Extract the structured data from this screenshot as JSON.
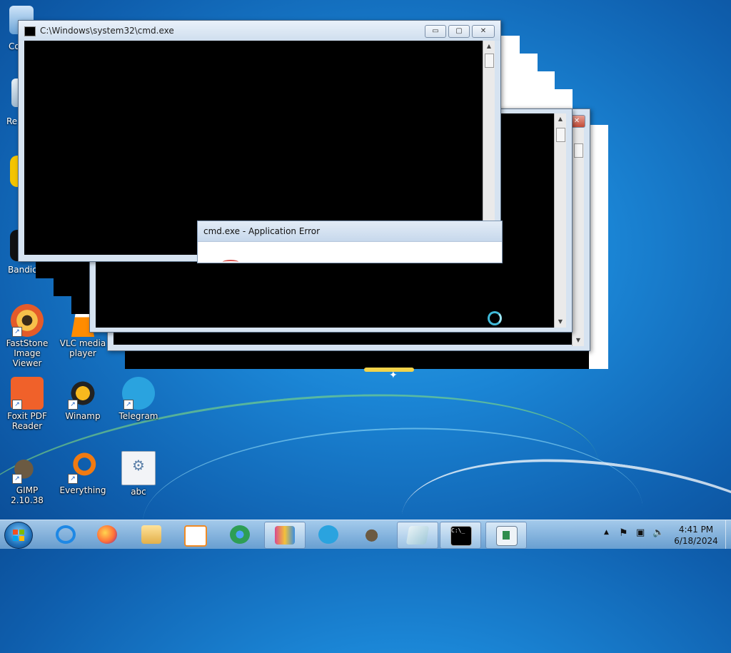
{
  "desktop": {
    "icons": [
      {
        "label": "FastStone\nImage Viewer"
      },
      {
        "label": "VLC media\nplayer"
      },
      {
        "label": "Foxit PDF\nReader"
      },
      {
        "label": "Winamp"
      },
      {
        "label": "Telegram"
      },
      {
        "label": "GIMP 2.10.38"
      },
      {
        "label": "Everything"
      },
      {
        "label": "abc"
      }
    ],
    "partial_labels": [
      "Co",
      "Re",
      "Bandic"
    ]
  },
  "cmd_window": {
    "title": "C:\\Windows\\system32\\cmd.exe",
    "minimize": "▭",
    "maximize": "▢",
    "close": "✕"
  },
  "error_window": {
    "title": "cmd.exe - Application Error"
  },
  "taskbar": {
    "apps": [
      "internet-explorer",
      "firefox",
      "file-explorer",
      "media-player",
      "chrome",
      "winrar",
      "telegram",
      "gimp",
      "notepad",
      "cmd",
      "window"
    ],
    "cmd_icon_text": "C:\\_",
    "clock_time": "4:41 PM",
    "clock_date": "6/18/2024",
    "tray_expand": "▲"
  }
}
